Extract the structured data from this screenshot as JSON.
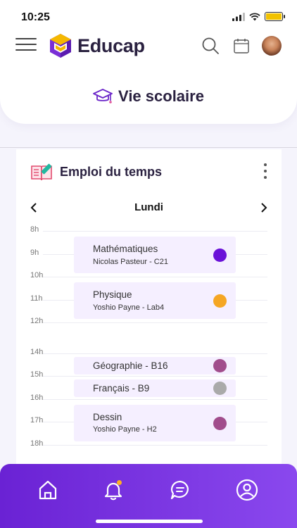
{
  "status_bar": {
    "time": "10:25"
  },
  "app": {
    "name": "Educap"
  },
  "page": {
    "title": "Vie scolaire"
  },
  "schedule": {
    "title": "Emploi du temps",
    "day": "Lundi",
    "hours": [
      "8h",
      "9h",
      "10h",
      "11h",
      "12h",
      "14h",
      "15h",
      "16h",
      "17h",
      "18h"
    ],
    "events": [
      {
        "title": "Mathématiques",
        "subtitle": "Nicolas Pasteur - C21",
        "color": "#6a12d8"
      },
      {
        "title": "Physique",
        "subtitle": "Yoshio Payne - Lab4",
        "color": "#f5a623"
      },
      {
        "title": "Géographie - B16",
        "subtitle": "",
        "color": "#a14d8c"
      },
      {
        "title": "Français - B9",
        "subtitle": "",
        "color": "#aaaaaa"
      },
      {
        "title": "Dessin",
        "subtitle": "Yoshio Payne - H2",
        "color": "#a14d8c"
      }
    ]
  },
  "bottom_nav": {
    "items": [
      {
        "icon": "home-icon"
      },
      {
        "icon": "bell-icon",
        "has_notification": true
      },
      {
        "icon": "chat-icon"
      },
      {
        "icon": "profile-icon"
      }
    ],
    "accent": "#7a35e6"
  }
}
